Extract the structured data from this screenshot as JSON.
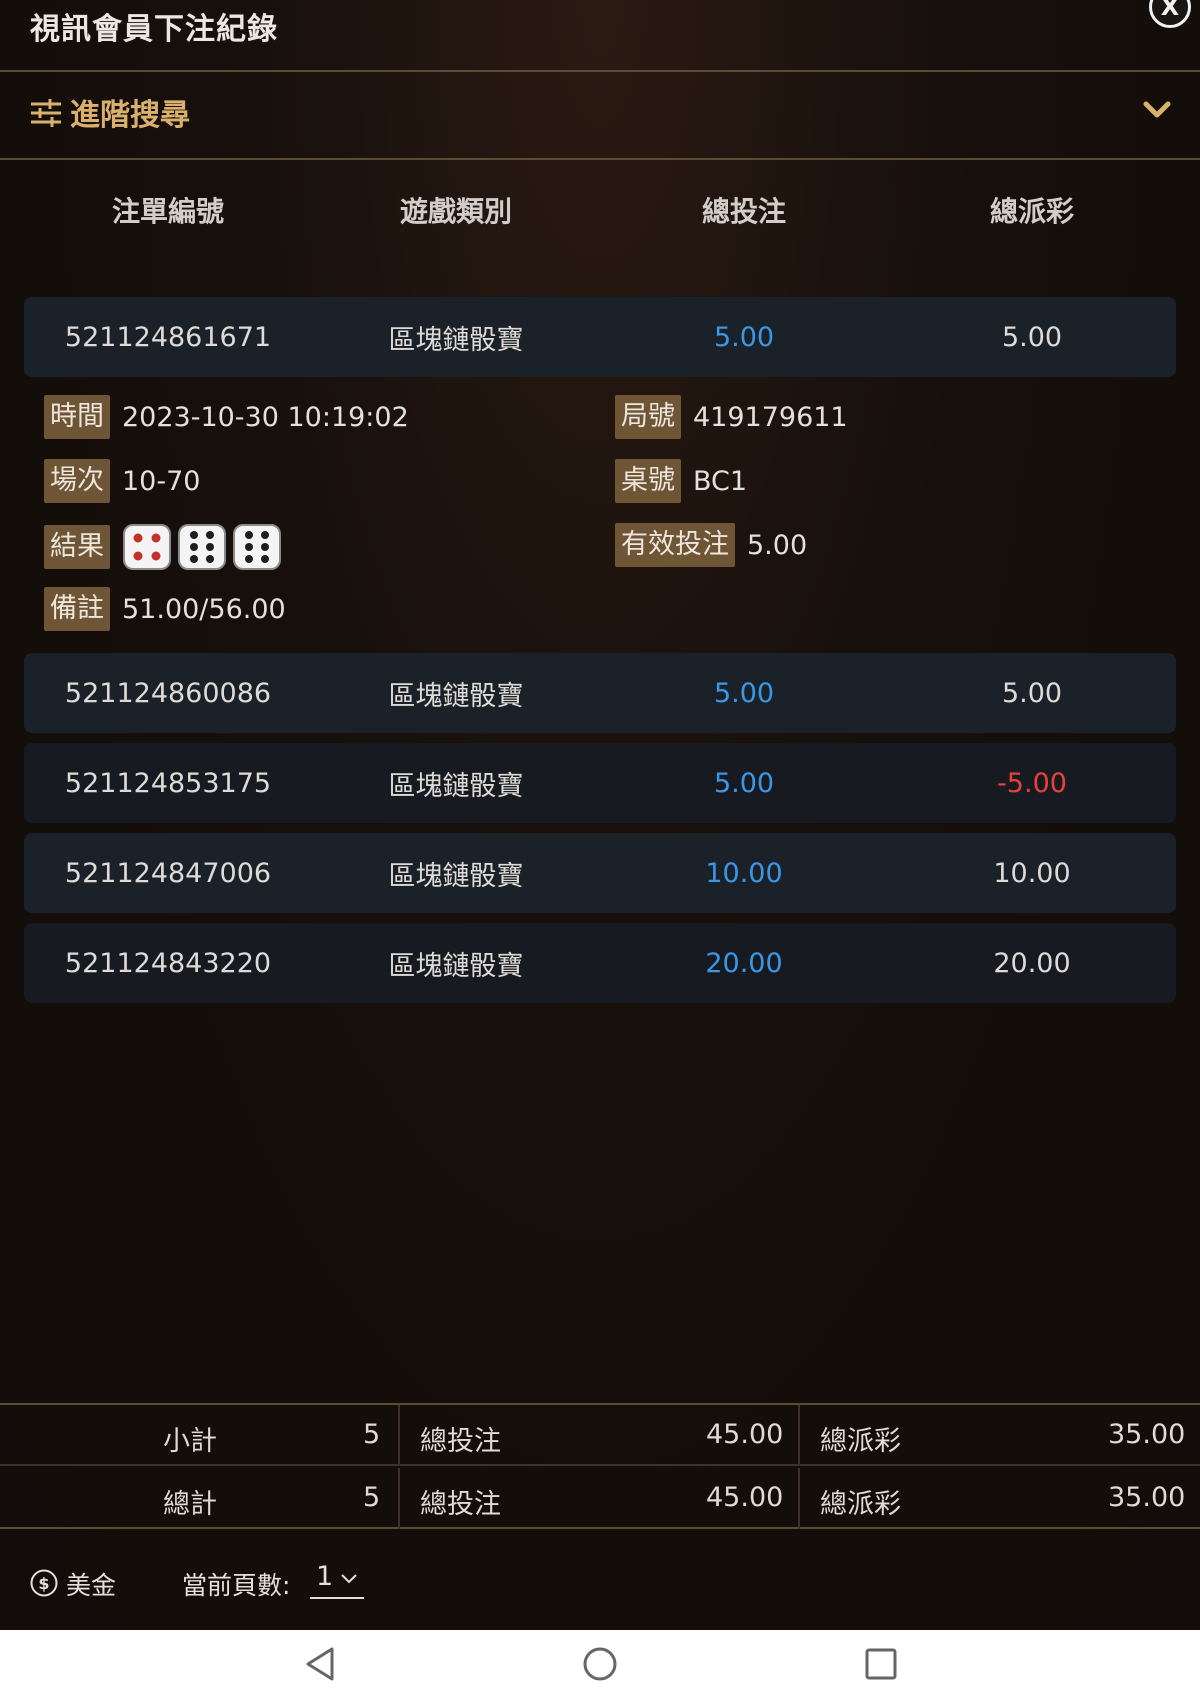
{
  "header": {
    "title": "視訊會員下注紀錄",
    "close_label": "X"
  },
  "search": {
    "label": "進階搜尋"
  },
  "table": {
    "columns": [
      "注單編號",
      "遊戲類別",
      "總投注",
      "總派彩"
    ],
    "rows": [
      {
        "id": "521124861671",
        "game": "區塊鏈骰寶",
        "stake": "5.00",
        "payout": "5.00"
      },
      {
        "id": "521124860086",
        "game": "區塊鏈骰寶",
        "stake": "5.00",
        "payout": "5.00"
      },
      {
        "id": "521124853175",
        "game": "區塊鏈骰寶",
        "stake": "5.00",
        "payout": "-5.00"
      },
      {
        "id": "521124847006",
        "game": "區塊鏈骰寶",
        "stake": "10.00",
        "payout": "10.00"
      },
      {
        "id": "521124843220",
        "game": "區塊鏈骰寶",
        "stake": "20.00",
        "payout": "20.00"
      }
    ]
  },
  "detail": {
    "time_label": "時間",
    "time": "2023-10-30 10:19:02",
    "round_label": "局號",
    "round": "419179611",
    "session_label": "場次",
    "session": "10-70",
    "table_label": "桌號",
    "table": "BC1",
    "result_label": "結果",
    "dice": [
      4,
      6,
      6
    ],
    "valid_label": "有效投注",
    "valid": "5.00",
    "note_label": "備註",
    "note": "51.00/56.00"
  },
  "summary": {
    "subtotal": {
      "label": "小計",
      "count": "5",
      "stake_label": "總投注",
      "stake": "45.00",
      "payout_label": "總派彩",
      "payout": "35.00"
    },
    "total": {
      "label": "總計",
      "count": "5",
      "stake_label": "總投注",
      "stake": "45.00",
      "payout_label": "總派彩",
      "payout": "35.00"
    }
  },
  "footer": {
    "currency": "美金",
    "page_label": "當前頁數:",
    "page": "1"
  },
  "colors": {
    "gold": "#d9b06c",
    "stake_blue": "#3a97e6",
    "negative_red": "#e6413b",
    "tag_bg": "#6d5535"
  }
}
